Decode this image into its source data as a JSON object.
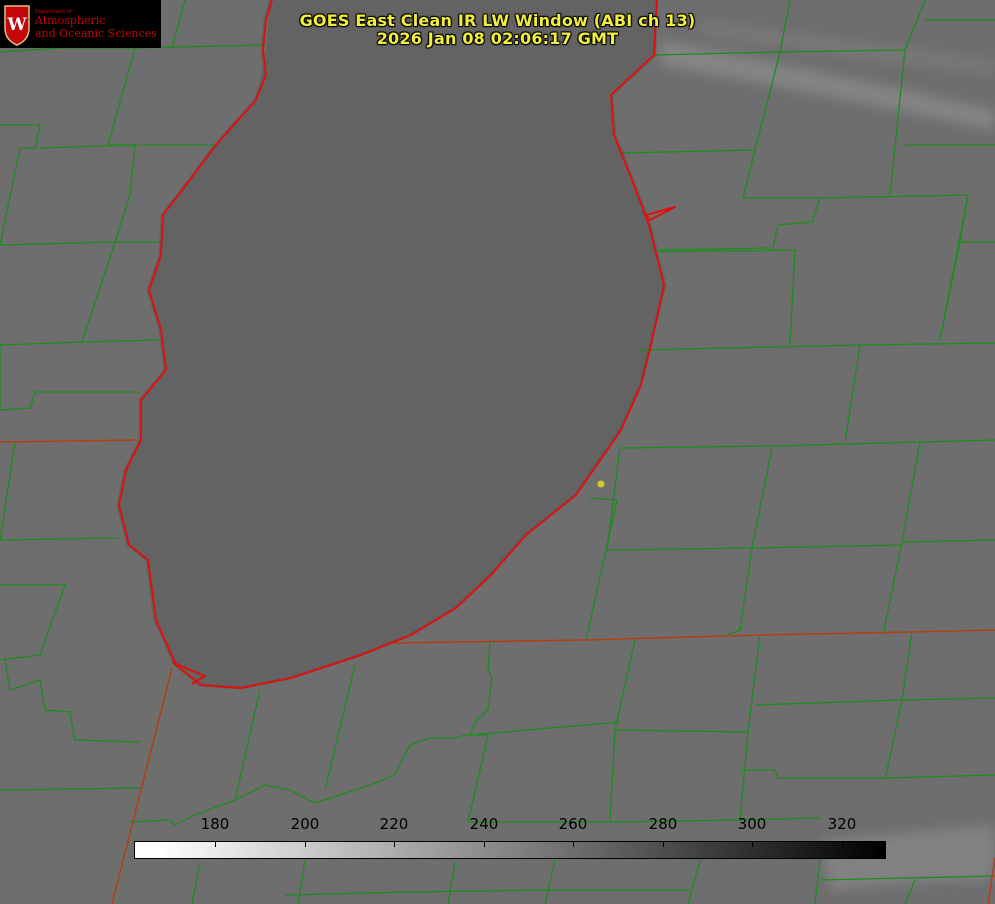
{
  "title": {
    "line1": "GOES East Clean IR LW Window (ABI ch 13)",
    "line2": "2026 Jan 08 02:06:17 GMT"
  },
  "logo": {
    "dept": "Department of",
    "line1": "Atmospheric",
    "line2": "and Oceanic Sciences",
    "crest_letter": "W",
    "crest_color": "#c5050c"
  },
  "colorbar": {
    "ticks": [
      "180",
      "200",
      "220",
      "240",
      "260",
      "280",
      "300",
      "320"
    ],
    "low_color": "#ffffff",
    "high_color": "#000000"
  },
  "map_colors": {
    "background": "#6e6e6e",
    "lake": "#636363",
    "county_lines": "#1e8c1e",
    "coastline": "#e01010",
    "state_line": "#b0401a",
    "marker": "#d8c828"
  }
}
